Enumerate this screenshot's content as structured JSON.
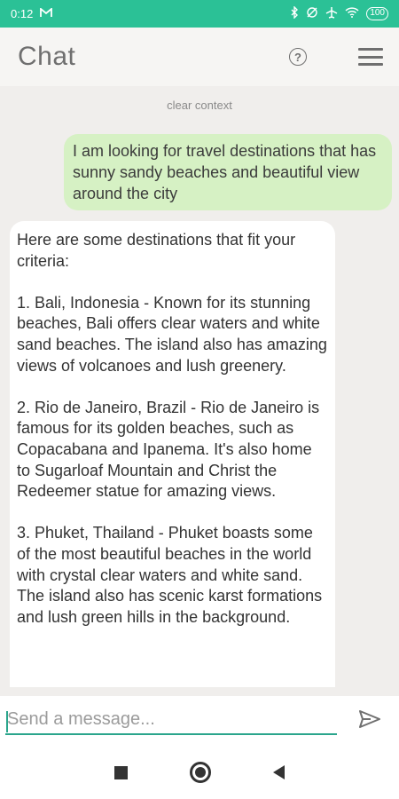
{
  "status_bar": {
    "time": "0:12",
    "notification_icon": "gmail-icon",
    "battery": "100"
  },
  "app_bar": {
    "title": "Chat",
    "help_icon": "help-circle-icon",
    "menu_icon": "hamburger-menu-icon"
  },
  "chat": {
    "clear_context": "clear context",
    "user_message": "I am looking for travel destinations that has sunny sandy beaches and beautiful view around the city",
    "bot_paragraphs": [
      "Here are some destinations that fit your criteria:",
      "1. Bali, Indonesia - Known for its stunning beaches, Bali offers clear waters and white sand beaches. The island also has amazing views of volcanoes and lush greenery.",
      "2. Rio de Janeiro, Brazil - Rio de Janeiro is famous for its golden beaches, such as Copacabana and Ipanema. It's also home to Sugarloaf Mountain and Christ the Redeemer statue for amazing views.",
      "3. Phuket, Thailand - Phuket boasts some of the most beautiful beaches in the world with crystal clear waters and white sand. The island also has scenic karst formations and lush green hills in the background."
    ]
  },
  "input": {
    "value": "",
    "placeholder": "Send a message...",
    "send_icon": "send-icon"
  },
  "colors": {
    "accent": "#2bc196",
    "user_bubble": "#d6f1c4",
    "bot_bubble": "#ffffff",
    "background": "#f0eeec"
  }
}
